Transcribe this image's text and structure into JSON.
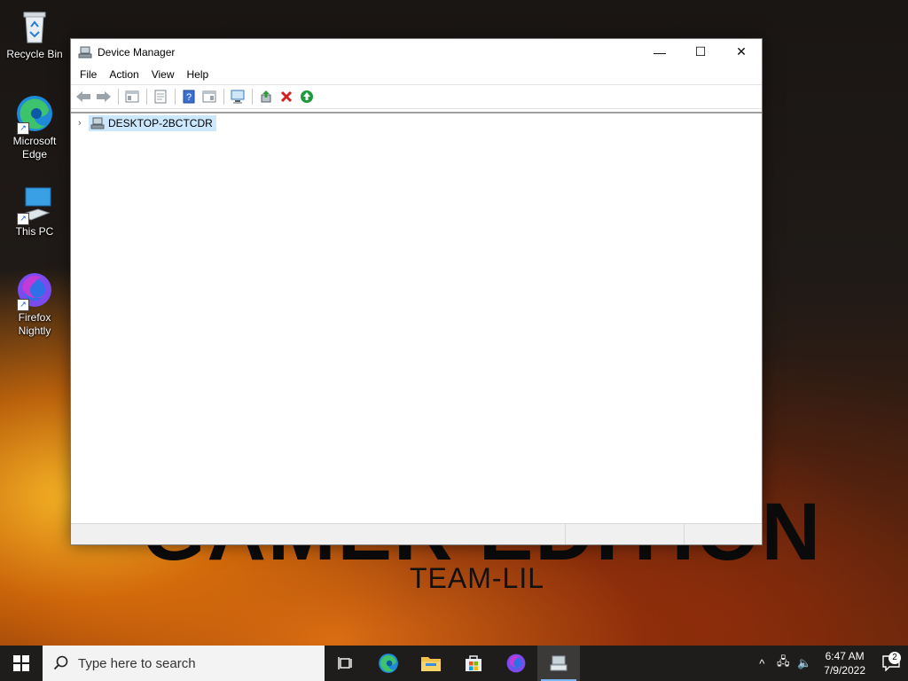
{
  "wallpaper": {
    "headline": "GAMER EDITION",
    "subtitle": "TEAM-LIL"
  },
  "desktop_icons": [
    {
      "label": "Recycle Bin",
      "icon": "recycle-bin-icon"
    },
    {
      "label": "Microsoft Edge",
      "icon": "edge-icon"
    },
    {
      "label": "This PC",
      "icon": "this-pc-icon"
    },
    {
      "label": "Firefox Nightly",
      "icon": "firefox-nightly-icon"
    }
  ],
  "window": {
    "title": "Device Manager",
    "caption": {
      "minimize": "—",
      "maximize": "☐",
      "close": "✕"
    },
    "menu": [
      "File",
      "Action",
      "View",
      "Help"
    ],
    "toolbar": [
      "back-icon",
      "forward-icon",
      "show-hide-console-tree-icon",
      "properties-icon",
      "help-icon",
      "action-pane-icon",
      "scan-hardware-icon",
      "update-driver-icon",
      "uninstall-device-icon",
      "enable-device-icon"
    ],
    "tree": {
      "root": "DESKTOP-2BCTCDR",
      "expander": "›"
    }
  },
  "taskbar": {
    "search_placeholder": "Type here to search",
    "apps": [
      "task-view-icon",
      "edge-icon",
      "file-explorer-icon",
      "microsoft-store-icon",
      "firefox-nightly-icon",
      "device-manager-icon"
    ],
    "active_app": "device-manager-icon",
    "tray_symbols": {
      "chevron": "^",
      "network": "🖧",
      "volume": "🔈"
    },
    "time": "6:47 AM",
    "date": "7/9/2022",
    "notification_count": "2"
  },
  "colors": {
    "accent": "#0078d7",
    "selection": "#cce8ff",
    "taskbar": "#1f1d1c"
  }
}
